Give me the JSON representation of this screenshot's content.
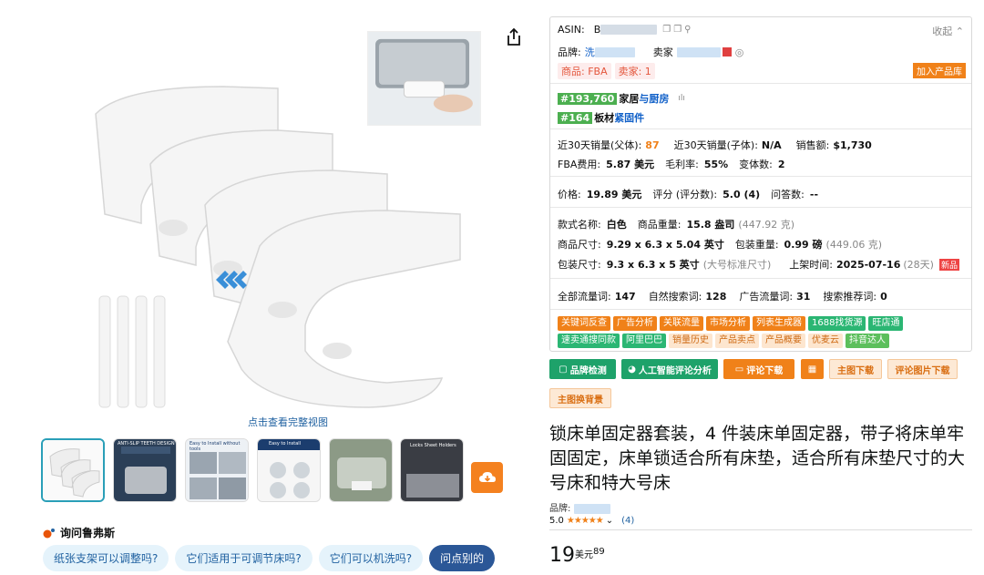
{
  "gallery": {
    "full_view_link": "点击查看完整视图",
    "thumbnails": [
      {
        "caption": ""
      },
      {
        "caption": "ANTI-SLIP TEETH DESIGN"
      },
      {
        "caption": "Easy to Install without tools"
      },
      {
        "caption": "Easy to Install"
      },
      {
        "caption": ""
      },
      {
        "caption": "Locks Sheet Holders"
      }
    ],
    "ask_label": "询问鲁弗斯",
    "questions": [
      "纸张支架可以调整吗?",
      "它们适用于可调节床吗?",
      "它们可以机洗吗?",
      "问点别的"
    ]
  },
  "panel": {
    "asin_label": "ASIN:",
    "asin_value": "B",
    "collapse": "收起",
    "brand_label": "品牌:",
    "brand_value": "洗",
    "seller_label": "卖家",
    "tag_fba": "商品: FBA",
    "tag_seller": "卖家: 1",
    "add_library": "加入产品库",
    "rank1_badge": "#193,760",
    "rank1_cat_a": "家居",
    "rank1_cat_b": "与厨房",
    "rank2_badge": "#164",
    "rank2_cat_a": "板材",
    "rank2_cat_b": "紧固件",
    "sales_parent_label": "近30天销量(父体):",
    "sales_parent_value": "87",
    "sales_child_label": "近30天销量(子体):",
    "sales_child_value": "N/A",
    "revenue_label": "销售额:",
    "revenue_value": "$1,730",
    "fba_fee_label": "FBA费用:",
    "fba_fee_value": "5.87 美元",
    "margin_label": "毛利率:",
    "margin_value": "55%",
    "variants_label": "变体数:",
    "variants_value": "2",
    "price_label": "价格:",
    "price_value": "19.89 美元",
    "rating_label": "评分 (评分数):",
    "rating_value": "5.0 (4)",
    "qa_label": "问答数:",
    "qa_value": "--",
    "style_label": "款式名称:",
    "style_value": "白色",
    "weight_label": "商品重量:",
    "weight_value": "15.8 盎司",
    "weight_g": "(447.92 克)",
    "size_label": "商品尺寸:",
    "size_value": "9.29 x 6.3 x 5.04 英寸",
    "pkg_weight_label": "包装重量:",
    "pkg_weight_value": "0.99 磅",
    "pkg_weight_g": "(449.06 克)",
    "pkg_size_label": "包装尺寸:",
    "pkg_size_value": "9.3 x 6.3 x 5 英寸",
    "pkg_size_note": "(大号标准尺寸)",
    "listed_label": "上架时间:",
    "listed_value": "2025-07-16",
    "listed_days": "(28天)",
    "new_badge": "新品",
    "kw_all_label": "全部流量词:",
    "kw_all_value": "147",
    "kw_org_label": "自然搜索词:",
    "kw_org_value": "128",
    "kw_ad_label": "广告流量词:",
    "kw_ad_value": "31",
    "kw_rec_label": "搜索推荐词:",
    "kw_rec_value": "0",
    "tools_row1": [
      "关键词反查",
      "广告分析",
      "关联流量",
      "市场分析",
      "列表生成器",
      "1688找货源",
      "旺店通"
    ],
    "tools_row2": [
      "速卖通搜同款",
      "阿里巴巴",
      "销量历史",
      "产品卖点",
      "产品概要",
      "优麦云",
      "抖音达人"
    ]
  },
  "actions": {
    "brand_check": "品牌检测",
    "ai_review": "人工智能评论分析",
    "review_download": "评论下载",
    "main_image_download": "主图下载",
    "review_image_download": "评论图片下载",
    "replace_bg": "主图换背景"
  },
  "product": {
    "title": "锁床单固定器套装，4 件装床单固定器，带子将床单牢固固定，床单锁适合所有床垫，适合所有床垫尺寸的大号床和特大号床",
    "brand_label": "品牌:",
    "rating_value": "5.0",
    "rating_count": "(4)",
    "price_whole": "19",
    "price_unit": "美元",
    "price_cents": "89"
  }
}
